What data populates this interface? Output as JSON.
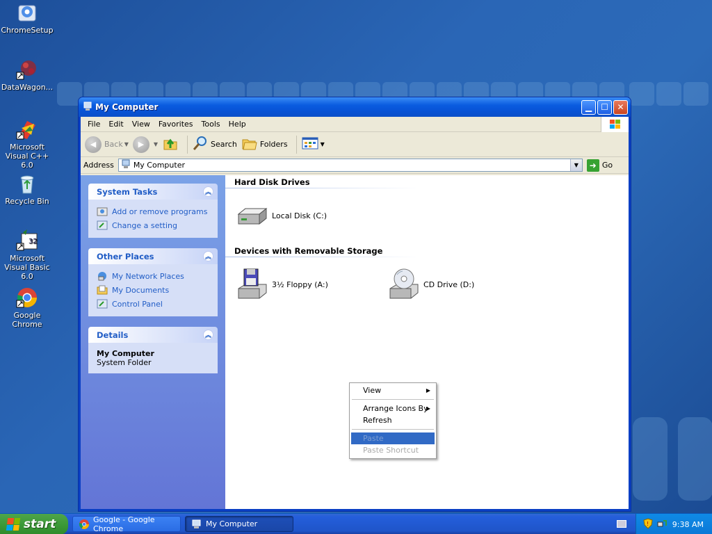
{
  "desktop": {
    "icons": [
      {
        "label": "ChromeSetup"
      },
      {
        "label": "DataWagon..."
      },
      {
        "label": "Microsoft Visual C++ 6.0"
      },
      {
        "label": "Recycle Bin"
      },
      {
        "label": "Microsoft Visual Basic 6.0"
      },
      {
        "label": "Google Chrome"
      }
    ]
  },
  "window": {
    "title": "My Computer",
    "menu": [
      "File",
      "Edit",
      "View",
      "Favorites",
      "Tools",
      "Help"
    ],
    "toolbar": {
      "back": "Back",
      "search": "Search",
      "folders": "Folders"
    },
    "address": {
      "label": "Address",
      "value": "My Computer",
      "go": "Go"
    },
    "left_pane": {
      "system_tasks": {
        "title": "System Tasks",
        "items": [
          "Add or remove programs",
          "Change a setting"
        ]
      },
      "other_places": {
        "title": "Other Places",
        "items": [
          "My Network Places",
          "My Documents",
          "Control Panel"
        ]
      },
      "details": {
        "title": "Details",
        "name": "My Computer",
        "type": "System Folder"
      }
    },
    "groups": [
      {
        "title": "Hard Disk Drives",
        "items": [
          "Local Disk (C:)"
        ]
      },
      {
        "title": "Devices with Removable Storage",
        "items": [
          "3½ Floppy (A:)",
          "CD Drive (D:)"
        ]
      }
    ]
  },
  "context_menu": {
    "items": [
      "View",
      "Arrange Icons By",
      "Refresh",
      "Paste",
      "Paste Shortcut"
    ]
  },
  "taskbar": {
    "start": "start",
    "buttons": [
      "Google - Google Chrome",
      "My Computer"
    ],
    "clock": "9:38 AM"
  },
  "colors": {
    "title_bar": "#0a5ce0",
    "task_pane": "#6f8edf",
    "taskbar": "#245edb",
    "start": "#3c9a38",
    "tray": "#0f8ae6"
  }
}
